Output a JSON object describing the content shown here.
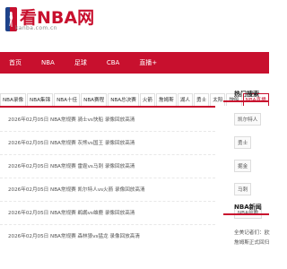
{
  "site": {
    "title": "看NBA网",
    "domain": "kanba.com.cn"
  },
  "nav": {
    "items": [
      "首页",
      "NBA",
      "足球",
      "CBA",
      "直播+"
    ]
  },
  "tabs": {
    "items": [
      "NBA录像",
      "NBA集锦",
      "NBA十佳",
      "NBA赛程",
      "NBA总决赛",
      "火箭",
      "詹姆斯",
      "湖人",
      "勇士",
      "太阳",
      "快船",
      "NBA直播"
    ],
    "active_index": 11
  },
  "news": {
    "items": [
      "2026年02月05日 NBA常规赛 骑士vs快船 录像回放高清",
      "2026年02月05日 NBA常规赛 灰熊vs国王 录像回放高清",
      "2026年02月05日 NBA常规赛 雷霆vs马刺 录像回放高清",
      "2026年02月05日 NBA常规赛 凯尔特人vs火箭 录像回放高清",
      "2026年02月05日 NBA常规赛 鹈鹕vs雄鹿 录像回放高清",
      "2026年02月05日 NBA常规赛 森林狼vs猛龙 录像回放高清"
    ]
  },
  "sidebar": {
    "hot_title": "热门搜索",
    "hot_tags": [
      "凯尔特人",
      "勇士",
      "掘金",
      "马刺",
      "NBA前瞻"
    ],
    "news_title": "NBA新闻",
    "news_items": [
      "全美记者们：欧文",
      "詹姆斯正式回归"
    ]
  },
  "colors": {
    "brand": "#c8102e",
    "text": "#333333",
    "muted": "#8a8a8a"
  }
}
